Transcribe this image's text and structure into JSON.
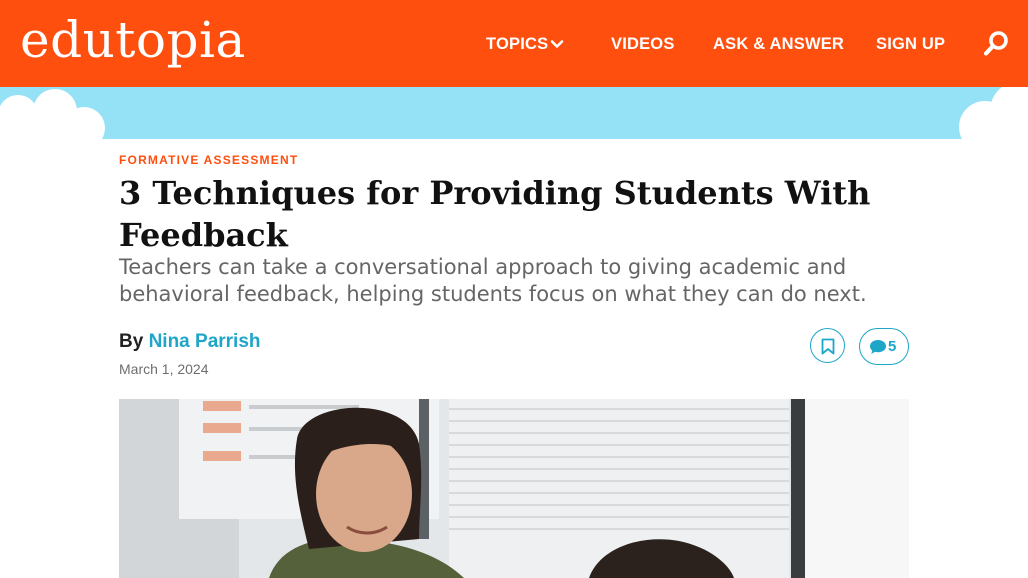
{
  "header": {
    "logo": "edutopia",
    "nav": {
      "topics": "TOPICS",
      "videos": "VIDEOS",
      "ask": "ASK & ANSWER",
      "signup": "SIGN UP"
    },
    "icons": {
      "topics_dropdown": "chevron-down-icon",
      "search": "search-icon"
    },
    "colors": {
      "brand": "#ff4f0f",
      "sky": "#95e2f7",
      "accent": "#1ea6c9"
    }
  },
  "article": {
    "kicker": "FORMATIVE ASSESSMENT",
    "title": "3 Techniques for Providing Students With Feedback",
    "dek": "Teachers can take a conversational approach to giving academic and behavioral feedback, helping students focus on what they can do next.",
    "byline_prefix": "By",
    "author": "Nina Parrish",
    "date": "March 1, 2024",
    "actions": {
      "bookmark_icon": "bookmark-icon",
      "comment_icon": "comment-icon",
      "comment_count": "5"
    }
  }
}
